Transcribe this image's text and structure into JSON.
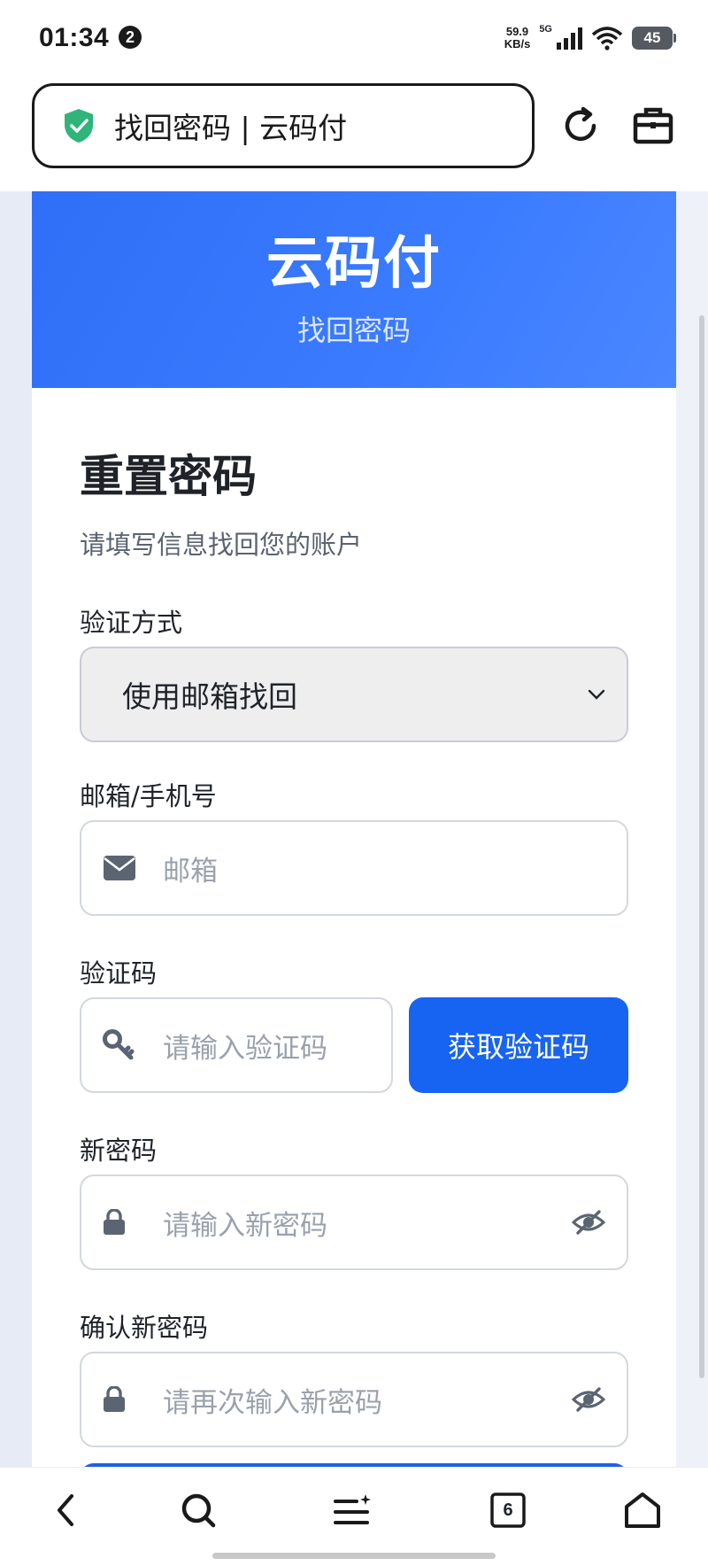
{
  "status_bar": {
    "time": "01:34",
    "notification_count": "2",
    "net_speed_value": "59.9",
    "net_speed_unit": "KB/s",
    "signal_label": "5G",
    "battery": "45"
  },
  "browser": {
    "address_text": "找回密码 | 云码付",
    "tab_count": "6"
  },
  "hero": {
    "title": "云码付",
    "subtitle": "找回密码"
  },
  "form": {
    "title": "重置密码",
    "subtitle": "请填写信息找回您的账户",
    "method_label": "验证方式",
    "method_value": "使用邮箱找回",
    "account_label": "邮箱/手机号",
    "account_placeholder": "邮箱",
    "code_label": "验证码",
    "code_placeholder": "请输入验证码",
    "code_button": "获取验证码",
    "new_pw_label": "新密码",
    "new_pw_placeholder": "请输入新密码",
    "confirm_pw_label": "确认新密码",
    "confirm_pw_placeholder": "请再次输入新密码"
  },
  "colors": {
    "accent": "#1763f2",
    "hero": "#3a7bff",
    "shield": "#2fb57a"
  }
}
